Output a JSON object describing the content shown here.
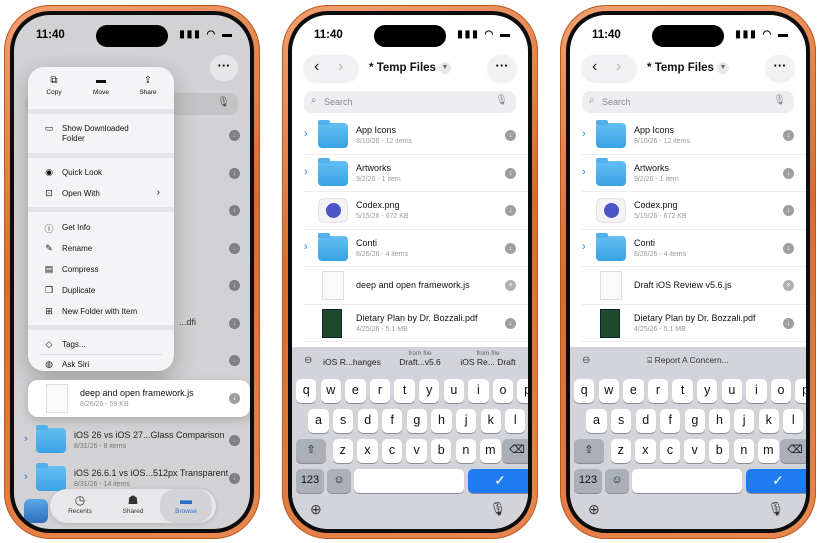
{
  "status": {
    "time": "11:40",
    "icons": "▮▮▮ ◠ ▬"
  },
  "phone1": {
    "context_menu": {
      "top_actions": [
        {
          "icon": "copy-icon",
          "glyph": "⧉",
          "label": "Copy"
        },
        {
          "icon": "folder-move-icon",
          "glyph": "▬",
          "label": "Move"
        },
        {
          "icon": "share-icon",
          "glyph": "⇪",
          "label": "Share"
        }
      ],
      "items": [
        {
          "icon": "folder-icon",
          "glyph": "▭",
          "label": "Show Downloaded",
          "label2": "Folder"
        },
        {
          "icon": "eye-icon",
          "glyph": "◉",
          "label": "Quick Look"
        },
        {
          "icon": "open-with-icon",
          "glyph": "⊡",
          "label": "Open With",
          "chevron": "›"
        },
        {
          "icon": "info-icon",
          "glyph": "ⓘ",
          "label": "Get Info"
        },
        {
          "icon": "pencil-icon",
          "glyph": "✎",
          "label": "Rename"
        },
        {
          "icon": "archive-icon",
          "glyph": "▤",
          "label": "Compress"
        },
        {
          "icon": "duplicate-icon",
          "glyph": "❐",
          "label": "Duplicate"
        },
        {
          "icon": "folder-plus-icon",
          "glyph": "⊞",
          "label": "New Folder with Item"
        },
        {
          "icon": "tag-icon",
          "glyph": "◇",
          "label": "Tags..."
        },
        {
          "icon": "siri-icon",
          "glyph": "◍",
          "label": "Ask Siri"
        }
      ]
    },
    "background_snippets": [
      "...dfi",
      "...dfi"
    ],
    "selected_file": {
      "name": "deep and open framework.js",
      "meta": "8/26/26 - 59 KB"
    },
    "rows": [
      {
        "name": "iOS 26 vs iOS 27...Glass Comparison",
        "meta": "8/31/26 - 8 items"
      },
      {
        "name": "iOS 26.6.1 vs iOS...512px Transparent",
        "meta": "8/31/26 - 14 items"
      }
    ],
    "tabs": [
      {
        "icon": "clock-icon",
        "glyph": "◷",
        "label": "Recents"
      },
      {
        "icon": "shared-icon",
        "glyph": "☗",
        "label": "Shared"
      },
      {
        "icon": "folder-icon",
        "glyph": "▬",
        "label": "Browse"
      }
    ]
  },
  "phone2": {
    "title": "* Temp Files",
    "search_placeholder": "Search",
    "files": [
      {
        "type": "folder",
        "name": "App Icons",
        "meta": "8/10/26 - 12 items"
      },
      {
        "type": "folder",
        "name": "Artworks",
        "meta": "9/2/26 - 1 item"
      },
      {
        "type": "png",
        "name": "Codex.png",
        "meta": "5/15/26 - 672 KB"
      },
      {
        "type": "folder",
        "name": "Conti",
        "meta": "8/26/26 - 4 items"
      },
      {
        "type": "js",
        "name": "deep and open framework.js",
        "meta": ""
      },
      {
        "type": "pdf",
        "name": "Dietary Plan by Dr. Bozzali.pdf",
        "meta": "4/25/26 - 5.1 MB"
      }
    ],
    "suggestions": [
      {
        "top": "",
        "bottom": "iOS R...hanges"
      },
      {
        "top": "from file",
        "bottom": "Draft...v5.6"
      },
      {
        "top": "from file",
        "bottom": "iOS Re... Draft"
      }
    ]
  },
  "phone3": {
    "title": "* Temp Files",
    "search_placeholder": "Search",
    "files": [
      {
        "type": "folder",
        "name": "App Icons",
        "meta": "8/10/26 - 12 items"
      },
      {
        "type": "folder",
        "name": "Artworks",
        "meta": "9/2/26 - 1 item"
      },
      {
        "type": "png",
        "name": "Codex.png",
        "meta": "5/15/26 - 672 KB"
      },
      {
        "type": "folder",
        "name": "Conti",
        "meta": "8/26/26 - 4 items"
      },
      {
        "type": "js",
        "name": "Draft iOS Review v5.6.js",
        "meta": ""
      },
      {
        "type": "pdf",
        "name": "Dietary Plan by Dr. Bozzali.pdf",
        "meta": "4/25/26 - 5.1 MB"
      }
    ],
    "report_label": "Report A Concern..."
  },
  "keyboard": {
    "row1": [
      "q",
      "w",
      "e",
      "r",
      "t",
      "y",
      "u",
      "i",
      "o",
      "p"
    ],
    "row2": [
      "a",
      "s",
      "d",
      "f",
      "g",
      "h",
      "j",
      "k",
      "l"
    ],
    "row3": [
      "z",
      "x",
      "c",
      "v",
      "b",
      "n",
      "m"
    ],
    "shift": "⇧",
    "delete": "⌫",
    "numbers": "123",
    "emoji": "☺",
    "return": "✓",
    "globe": "⊕",
    "mic": "🎙"
  },
  "colors": {
    "accent": "#1e7cf2",
    "phone_frame": "#d86c2e",
    "folder": "#3aa2e4"
  }
}
